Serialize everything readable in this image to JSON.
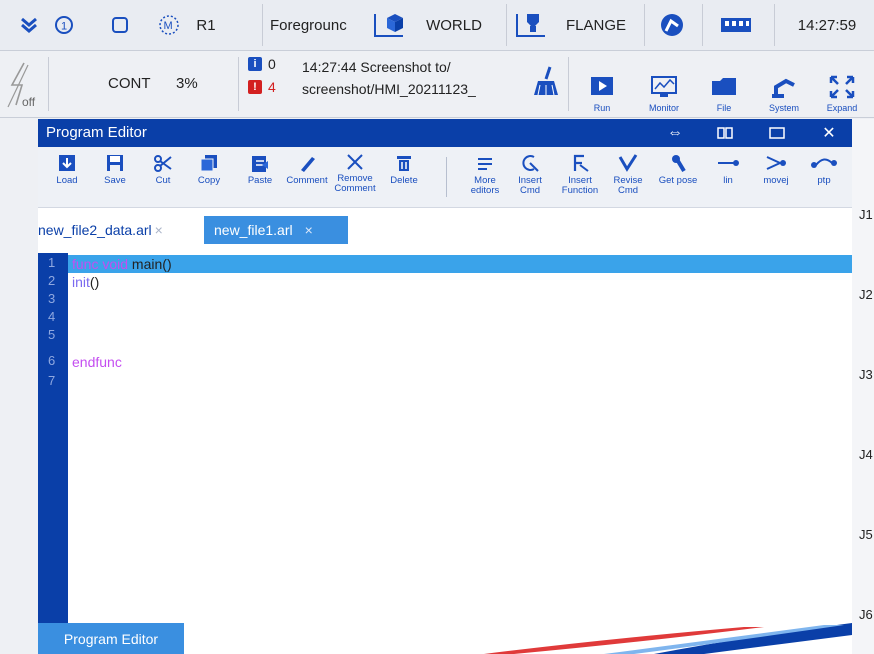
{
  "topbar": {
    "robot": "R1",
    "run_mode": "Foregrounc",
    "coord": "WORLD",
    "tool": "FLANGE",
    "clock": "14:27:59"
  },
  "statusbar": {
    "servo_state": "off",
    "motion_mode": "CONT",
    "speed": "3%",
    "info_count": "0",
    "error_count": "4",
    "message_line1": "14:27:44 Screenshot to/",
    "message_line2": "screenshot/HMI_20211123_",
    "buttons": [
      "Run",
      "Monitor",
      "File",
      "System",
      "Expand"
    ]
  },
  "window": {
    "title": "Program Editor",
    "toolbar": [
      "Load",
      "Save",
      "Cut",
      "Copy",
      "Paste",
      "Comment",
      "Remove Comment",
      "Delete",
      "More editors",
      "Insert Cmd",
      "Insert Function",
      "Revise Cmd",
      "Get pose",
      "lin",
      "movej",
      "ptp"
    ],
    "tabs": [
      {
        "label": "new_file2_data.arl",
        "close": "×"
      },
      {
        "label": "new_file1.arl",
        "close": "×"
      }
    ],
    "lines": [
      {
        "no": "1",
        "kw": "func void",
        "rest": " main()"
      },
      {
        "no": "2",
        "fn": "init",
        "rest": "()"
      },
      {
        "no": "3"
      },
      {
        "no": "4"
      },
      {
        "no": "5"
      },
      {
        "no": "6",
        "kw": "endfunc"
      },
      {
        "no": "7"
      }
    ],
    "footer_tab": "Program Editor"
  },
  "joints": [
    "J1",
    "J2",
    "J3",
    "J4",
    "J5",
    "J6"
  ],
  "colors": {
    "accent": "#0a3fa8",
    "highlight": "#3aa3ea",
    "keyword": "#c44ef0",
    "error": "#d32020"
  }
}
